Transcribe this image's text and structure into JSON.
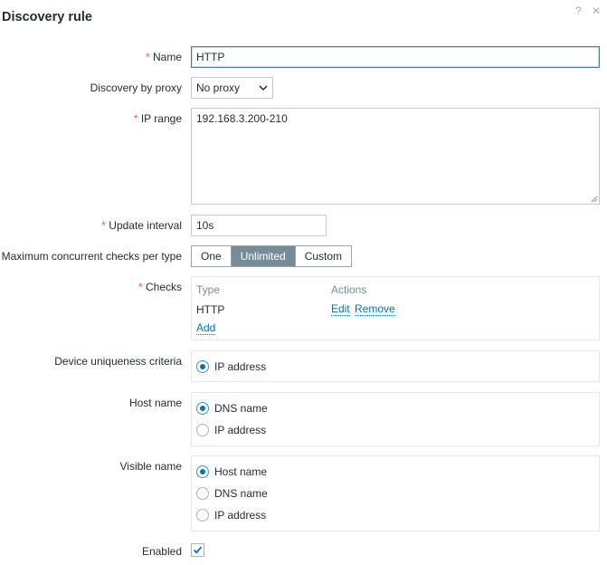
{
  "dialog": {
    "title": "Discovery rule",
    "help_icon": "?",
    "close_icon": "✕"
  },
  "form": {
    "name": {
      "label": "Name",
      "value": "HTTP",
      "required": true
    },
    "proxy": {
      "label": "Discovery by proxy",
      "value": "No proxy"
    },
    "ip_range": {
      "label": "IP range",
      "value": "192.168.3.200-210",
      "required": true
    },
    "update_interval": {
      "label": "Update interval",
      "value": "10s",
      "required": true
    },
    "concurrent": {
      "label": "Maximum concurrent checks per type",
      "options": [
        "One",
        "Unlimited",
        "Custom"
      ],
      "selected": "Unlimited"
    },
    "checks": {
      "label": "Checks",
      "required": true,
      "col_type": "Type",
      "col_actions": "Actions",
      "rows": [
        {
          "type": "HTTP",
          "edit": "Edit",
          "remove": "Remove"
        }
      ],
      "add": "Add"
    },
    "uniqueness": {
      "label": "Device uniqueness criteria",
      "options": [
        "IP address"
      ],
      "selected": "IP address"
    },
    "host_name": {
      "label": "Host name",
      "options": [
        "DNS name",
        "IP address"
      ],
      "selected": "DNS name"
    },
    "visible_name": {
      "label": "Visible name",
      "options": [
        "Host name",
        "DNS name",
        "IP address"
      ],
      "selected": "Host name"
    },
    "enabled": {
      "label": "Enabled",
      "checked": true
    }
  },
  "colors": {
    "accent": "#0275b8",
    "required": "#e45959",
    "segment_active": "#768d99"
  }
}
